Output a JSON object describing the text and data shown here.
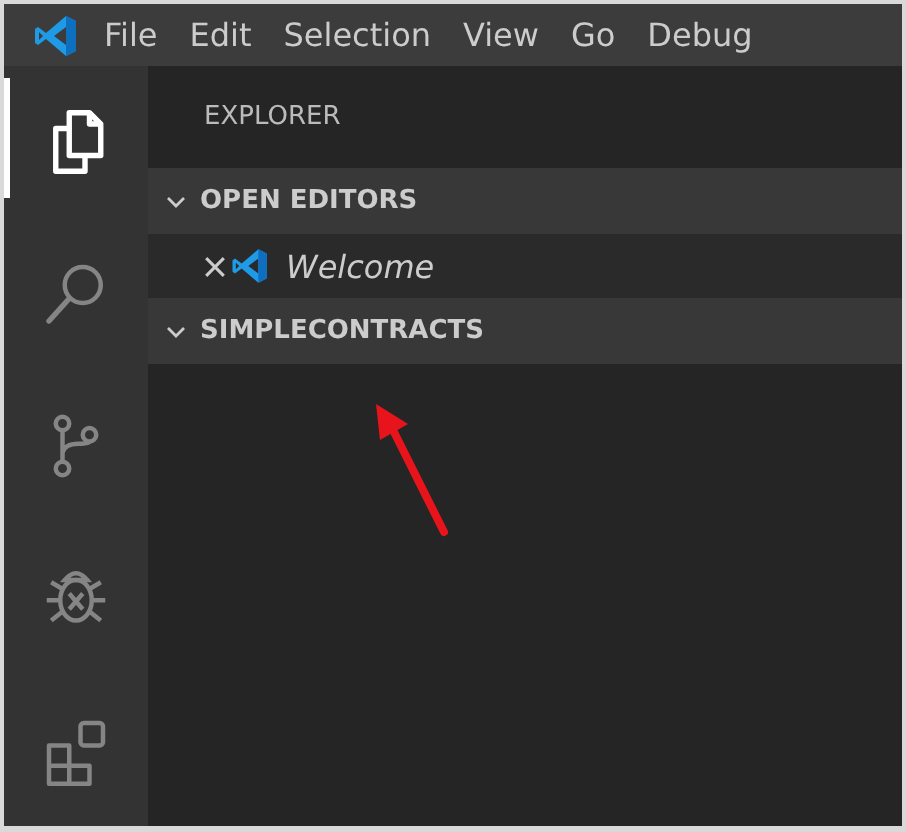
{
  "menu_bar": {
    "items": [
      "File",
      "Edit",
      "Selection",
      "View",
      "Go",
      "Debug"
    ]
  },
  "activity_bar": {
    "items": [
      {
        "kind": "explorer",
        "selected": true
      },
      {
        "kind": "search",
        "selected": false
      },
      {
        "kind": "source-control",
        "selected": false
      },
      {
        "kind": "debug",
        "selected": false
      },
      {
        "kind": "extensions",
        "selected": false
      }
    ]
  },
  "sidebar": {
    "title": "EXPLORER",
    "sections": [
      {
        "label": "OPEN EDITORS",
        "expanded": true,
        "items": [
          {
            "label": "Welcome"
          }
        ]
      },
      {
        "label": "SIMPLECONTRACTS",
        "expanded": true
      }
    ]
  }
}
